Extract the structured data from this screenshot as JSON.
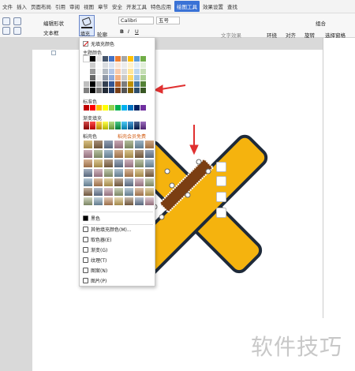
{
  "tabs": [
    "文件",
    "插入",
    "页面布局",
    "引用",
    "审阅",
    "视图",
    "章节",
    "安全",
    "开发工具",
    "特色应用",
    "绘图工具",
    "效果设置",
    "查找"
  ],
  "active_tab": "绘图工具",
  "ribbon": {
    "edit_shape": "编辑形状",
    "textbox": "文本框",
    "fill": "填充",
    "outline": "轮廓",
    "font_name": "Calibri",
    "font_size": "五号",
    "text_effects": "文字效果",
    "wrap": "环绕",
    "align": "对齐",
    "rotate": "旋转",
    "select_pane": "选择窗格",
    "combine": "组合",
    "bold": "B",
    "italic": "I",
    "underline": "U"
  },
  "menu": {
    "no_fill": "无填充颜色",
    "theme_colors": "主题颜色",
    "standard_colors": "标准色",
    "gradient_fill": "渐变填充",
    "fill_presets": "稻壳色",
    "member_label": "稻壳会员免费",
    "black": "黑色",
    "more_colors": "其他填充颜色(M)...",
    "eyedropper": "取色器(E)",
    "gradient": "渐变(G)",
    "texture": "纹理(T)",
    "pattern": "图案(N)",
    "picture": "图片(P)"
  },
  "colors": {
    "theme_top": [
      "#ffffff",
      "#000000",
      "#e7e6e6",
      "#44546a",
      "#4472c4",
      "#ed7d31",
      "#a5a5a5",
      "#ffc000",
      "#5b9bd5",
      "#70ad47"
    ],
    "standard": [
      "#c00000",
      "#ff0000",
      "#ffc000",
      "#ffff00",
      "#92d050",
      "#00b050",
      "#00b0f0",
      "#0070c0",
      "#002060",
      "#7030a0"
    ],
    "shape_fill": "#f5b30e",
    "shape_stroke": "#1e2a3a",
    "bar_fill": "#7b3e12"
  },
  "watermark": "软件技巧"
}
